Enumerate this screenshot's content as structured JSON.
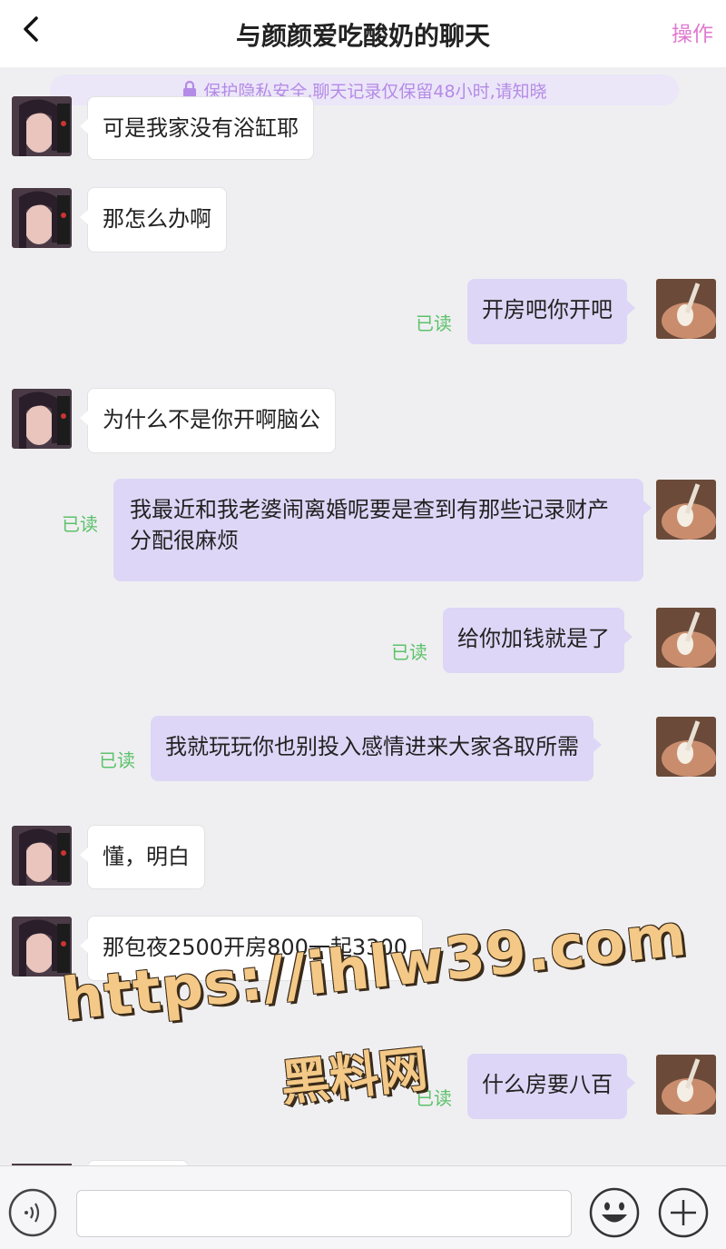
{
  "header": {
    "title": "与颜颜爱吃酸奶的聊天",
    "action_label": "操作"
  },
  "notice": {
    "text": "保护隐私安全,聊天记录仅保留48小时,请知晓"
  },
  "messages": [
    {
      "side": "left",
      "text": "可是我家没有浴缸耶"
    },
    {
      "side": "left",
      "text": "那怎么办啊"
    },
    {
      "side": "right",
      "text": "开房吧你开吧",
      "status": "已读"
    },
    {
      "side": "left",
      "text": "为什么不是你开啊脑公"
    },
    {
      "side": "right",
      "text": "我最近和我老婆闹离婚呢要是查到有那些记录财产分配很麻烦",
      "status": "已读"
    },
    {
      "side": "right",
      "text": "给你加钱就是了",
      "status": "已读"
    },
    {
      "side": "right",
      "text": "我就玩玩你也别投入感情进来大家各取所需",
      "status": "已读"
    },
    {
      "side": "left",
      "text": "懂，明白"
    },
    {
      "side": "left",
      "text": "那包夜2500开房800一起3300"
    },
    {
      "side": "right",
      "text": "什么房要八百",
      "status": "已读"
    }
  ],
  "watermark": {
    "line1": "https://ihlw39.com",
    "line2": "黑料网"
  },
  "input": {
    "value": "",
    "placeholder": ""
  },
  "colors": {
    "accent": "#e07ad0",
    "notice_text": "#b48be6",
    "notice_bg": "#ece6f9",
    "right_bubble": "#ddd6f6",
    "read_status": "#5cc26a",
    "background": "#efeff1"
  },
  "icons": {
    "back": "chevron-left-icon",
    "lock": "lock-icon",
    "voice": "voice-icon",
    "emoji": "smiley-icon",
    "plus": "plus-icon"
  }
}
